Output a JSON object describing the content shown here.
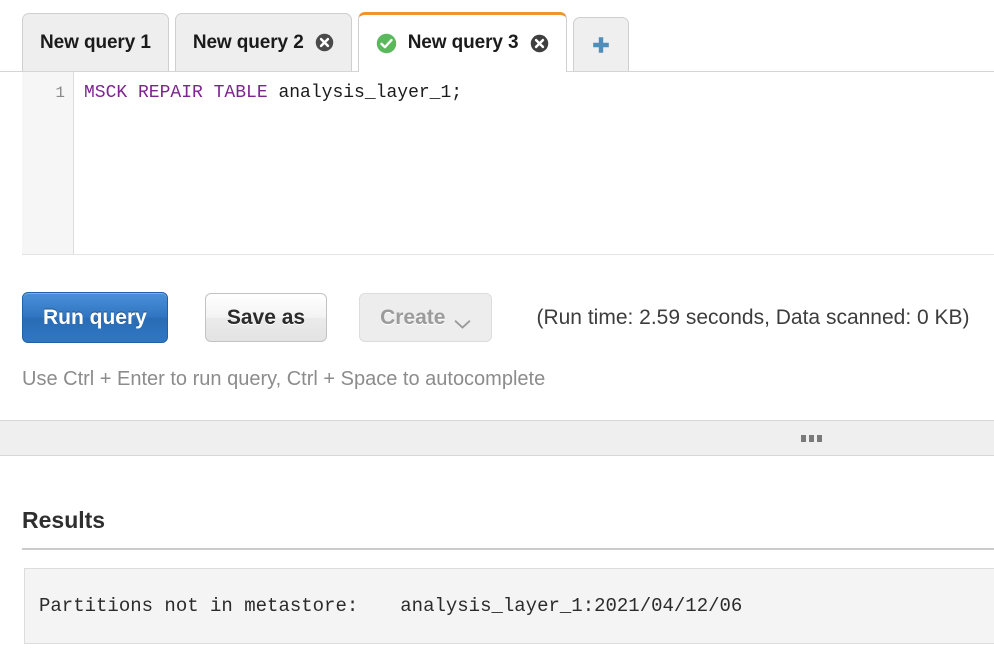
{
  "tabs": [
    {
      "label": "New query 1",
      "active": false,
      "closable": false,
      "status": null
    },
    {
      "label": "New query 2",
      "active": false,
      "closable": true,
      "status": null
    },
    {
      "label": "New query 3",
      "active": true,
      "closable": true,
      "status": "success-check-icon"
    }
  ],
  "new_tab_button": {
    "icon": "plus-icon"
  },
  "editor": {
    "line_number": "1",
    "keywords": "MSCK REPAIR TABLE",
    "rest": " analysis_layer_1;",
    "full_text": "MSCK REPAIR TABLE analysis_layer_1;",
    "keyword_color": "#7d258e"
  },
  "toolbar": {
    "run_label": "Run query",
    "save_label": "Save as",
    "create_label": "Create",
    "create_disabled": true,
    "run_info": "(Run time: 2.59 seconds, Data scanned: 0 KB)",
    "run_time": "2.59 seconds",
    "data_scanned": "0 KB"
  },
  "hint": "Use Ctrl + Enter to run query, Ctrl + Space to autocomplete",
  "splitter": {
    "handle_icon": "grip-dots-icon"
  },
  "results": {
    "title": "Results",
    "rows": [
      {
        "col1": "Partitions not in metastore:",
        "col2": "analysis_layer_1:2021/04/12/06"
      }
    ]
  },
  "colors": {
    "accent_tab": "#f0952a",
    "primary_button": "#2f74c0",
    "success": "#5cb85c",
    "keyword": "#7d258e"
  }
}
